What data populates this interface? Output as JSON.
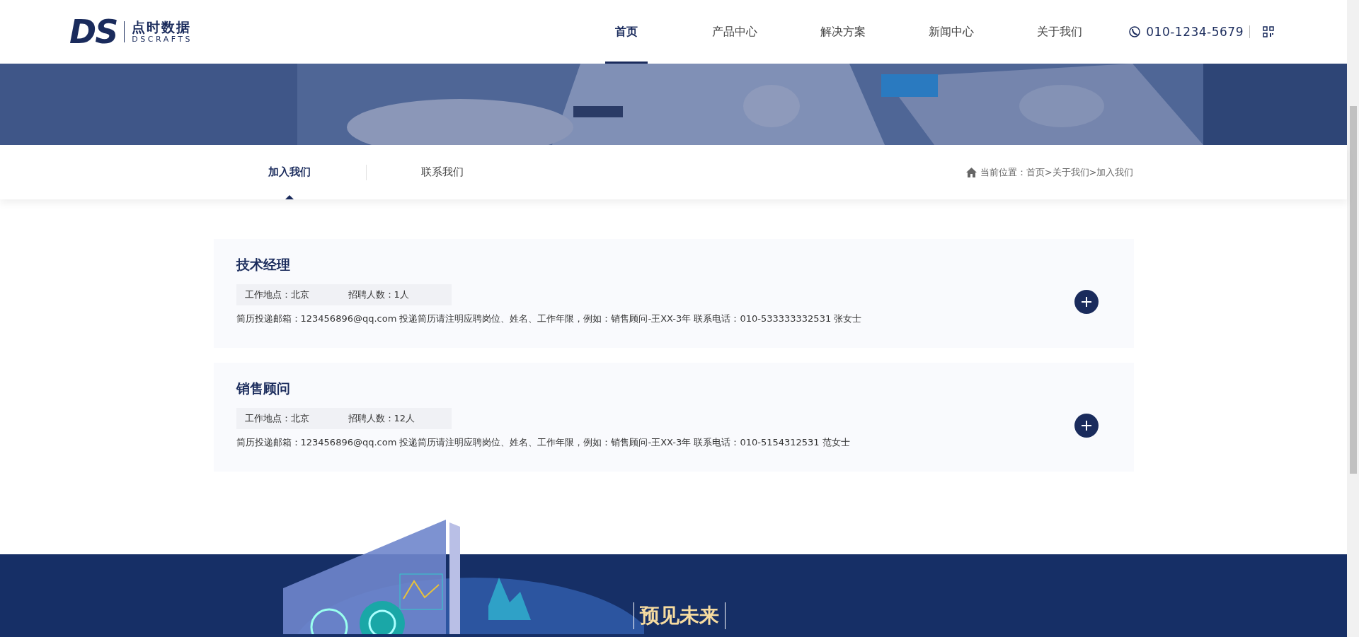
{
  "header": {
    "logo": {
      "mark": "DS",
      "name": "点时数据",
      "sub": "DSCRAFTS"
    },
    "nav": [
      {
        "label": "首页",
        "selected": true
      },
      {
        "label": "产品中心",
        "selected": false
      },
      {
        "label": "解决方案",
        "selected": false
      },
      {
        "label": "新闻中心",
        "selected": false
      },
      {
        "label": "关于我们",
        "selected": false
      }
    ],
    "phone": "010-1234-5679"
  },
  "subnav": {
    "tabs": [
      {
        "label": "加入我们",
        "selected": true
      },
      {
        "label": "联系我们",
        "selected": false
      }
    ],
    "breadcrumb": "当前位置：首页>关于我们>加入我们"
  },
  "jobs": [
    {
      "title": "技术经理",
      "location": "工作地点：北京",
      "headcount": "招聘人数：1人",
      "description": "简历投递邮箱：123456896@qq.com 投递简历请注明应聘岗位、姓名、工作年限，例如：销售顾问-王XX-3年 联系电话：010-533333332531 张女士",
      "expanded": false
    },
    {
      "title": "销售顾问",
      "location": "工作地点：北京",
      "headcount": "招聘人数：12人",
      "description": "简历投递邮箱：123456896@qq.com 投递简历请注明应聘岗位、姓名、工作年限，例如：销售顾问-王XX-3年 联系电话：010-5154312531 范女士",
      "expanded": false
    }
  ],
  "footer": {
    "heading": "预见未来"
  }
}
